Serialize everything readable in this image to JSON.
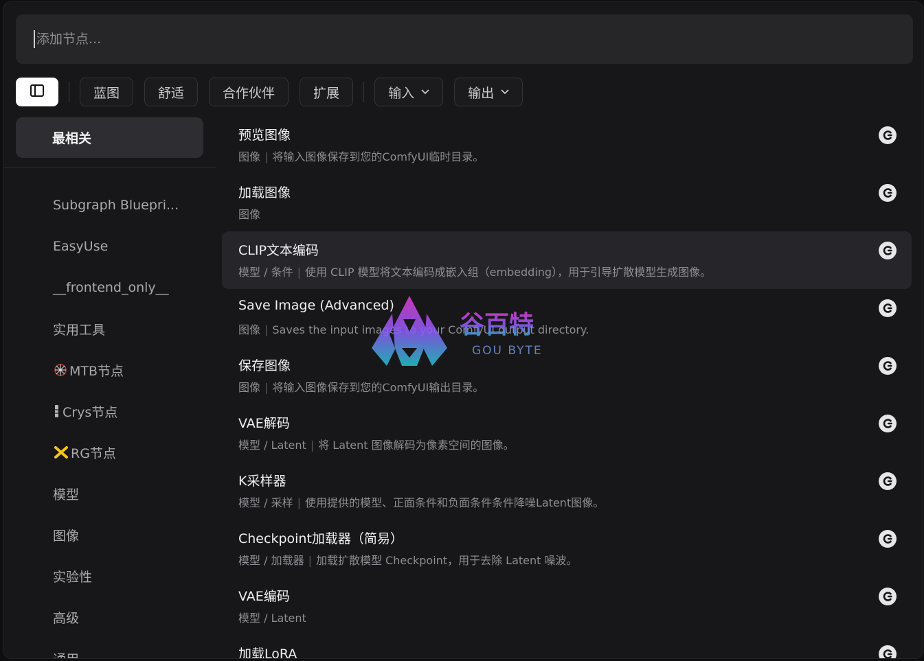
{
  "search": {
    "placeholder": "添加节点..."
  },
  "filters": {
    "toggle_icon": "sidebar-panel-icon",
    "chips": [
      "蓝图",
      "舒适",
      "合作伙伴",
      "扩展"
    ],
    "dropdowns": [
      {
        "label": "输入",
        "icon": "chevron-down-icon"
      },
      {
        "label": "输出",
        "icon": "chevron-down-icon"
      }
    ]
  },
  "sidebar": {
    "active": "最相关",
    "categories": [
      {
        "label": "Subgraph Bluepri..."
      },
      {
        "label": "EasyUse"
      },
      {
        "label": "__frontend_only__"
      },
      {
        "label": "实用工具"
      },
      {
        "label": "MTB节点",
        "icon": "ferris-wheel-icon"
      },
      {
        "label": "Crys节点",
        "icon": "crystal-bar-icon"
      },
      {
        "label": "RG节点",
        "icon": "cross-star-icon"
      },
      {
        "label": "模型"
      },
      {
        "label": "图像"
      },
      {
        "label": "实验性"
      },
      {
        "label": "高级"
      },
      {
        "label": "通用"
      }
    ]
  },
  "results": [
    {
      "title": "预览图像",
      "category": "图像",
      "description": "将输入图像保存到您的ComfyUI临时目录。"
    },
    {
      "title": "加载图像",
      "category": "图像",
      "description": ""
    },
    {
      "title": "CLIP文本编码",
      "category": "模型 / 条件",
      "description": "使用 CLIP 模型将文本编码成嵌入组（embedding），用于引导扩散模型生成图像。",
      "highlighted": true
    },
    {
      "title": "Save Image (Advanced)",
      "category": "图像",
      "description": "Saves the input images to your ComfyUI output directory."
    },
    {
      "title": "保存图像",
      "category": "图像",
      "description": "将输入图像保存到您的ComfyUI输出目录。"
    },
    {
      "title": "VAE解码",
      "category": "模型 / Latent",
      "description": "将 Latent 图像解码为像素空间的图像。"
    },
    {
      "title": "K采样器",
      "category": "模型 / 采样",
      "description": "使用提供的模型、正面条件和负面条件条件降噪Latent图像。"
    },
    {
      "title": "Checkpoint加载器（简易）",
      "category": "模型 / 加载器",
      "description": "加载扩散模型 Checkpoint，用于去除 Latent 噪波。"
    },
    {
      "title": "VAE编码",
      "category": "模型 / Latent",
      "description": ""
    },
    {
      "title": "加载LoRA",
      "category": "",
      "description": ""
    }
  ],
  "badge_icon": "comfy-logo-icon",
  "watermark": {
    "cn": "谷百特",
    "en": "GOU BYTE"
  }
}
